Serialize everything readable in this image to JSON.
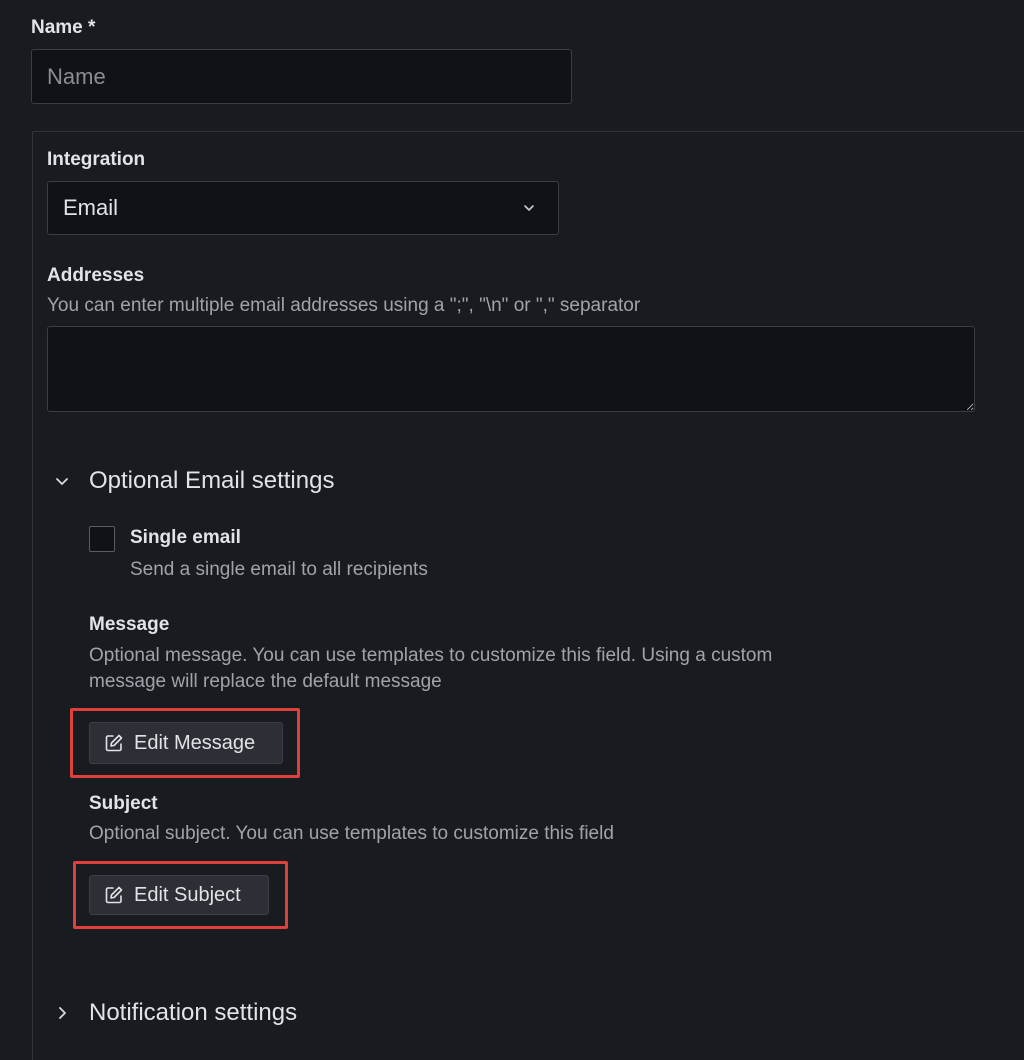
{
  "name_field": {
    "label": "Name *",
    "placeholder": "Name",
    "value": ""
  },
  "integration": {
    "label": "Integration",
    "selected": "Email"
  },
  "addresses": {
    "label": "Addresses",
    "description": "You can enter multiple email addresses using a \";\", \"\\n\" or \",\" separator",
    "value": ""
  },
  "optional_settings": {
    "title": "Optional Email settings",
    "expanded": true,
    "single_email": {
      "label": "Single email",
      "description": "Send a single email to all recipients",
      "checked": false
    },
    "message": {
      "label": "Message",
      "description_line1": "Optional message. You can use templates to customize this field. Using a custom",
      "description_line2": "message will replace the default message",
      "button_label": "Edit Message",
      "button_icon": "edit-icon"
    },
    "subject": {
      "label": "Subject",
      "description": "Optional subject. You can use templates to customize this field",
      "button_label": "Edit Subject",
      "button_icon": "edit-icon"
    }
  },
  "notification_settings": {
    "title": "Notification settings",
    "expanded": false
  },
  "colors": {
    "background": "#181b1f",
    "highlight": "#e0403b"
  }
}
